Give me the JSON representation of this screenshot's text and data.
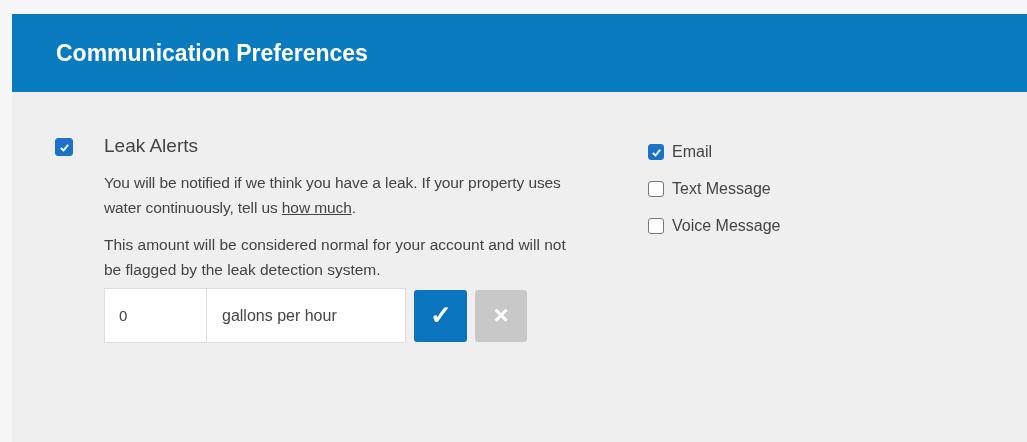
{
  "panel": {
    "title": "Communication Preferences"
  },
  "alert": {
    "label": "Leak Alerts",
    "checked": true,
    "description": {
      "before": "You will be notified if we think you have a leak. If your property uses water continuously, tell us ",
      "link": "how much",
      "after": "."
    },
    "note": "This amount will be considered normal for your account and will not be flagged by the leak detection system.",
    "amount": {
      "value": "0",
      "unit": "gallons per hour"
    },
    "confirm": {
      "label": "✓"
    },
    "cancel": {
      "label": "×",
      "disabled": true
    }
  },
  "channels": [
    {
      "label": "Email",
      "checked": true
    },
    {
      "label": "Text Message",
      "checked": false
    },
    {
      "label": "Voice Message",
      "checked": false
    }
  ]
}
